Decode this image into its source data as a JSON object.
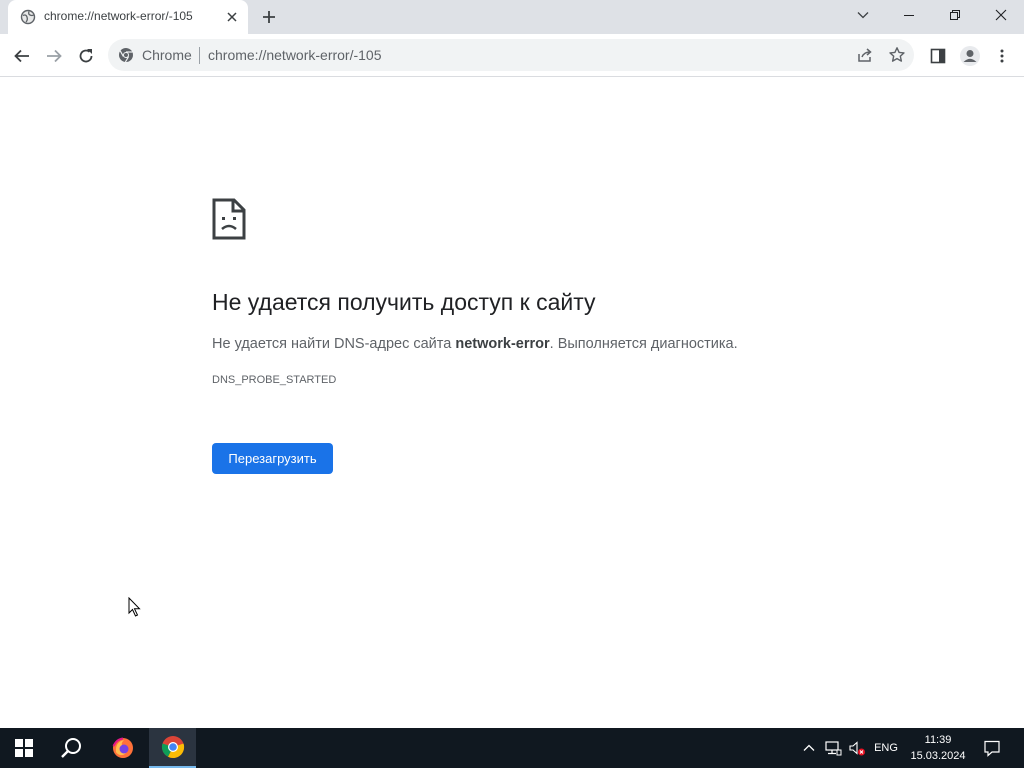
{
  "tab": {
    "title": "chrome://network-error/-105"
  },
  "omnibox": {
    "chip": "Chrome",
    "url": "chrome://network-error/-105"
  },
  "error": {
    "title": "Не удается получить доступ к сайту",
    "desc_prefix": "Не удается найти DNS-адрес сайта ",
    "desc_host": "network-error",
    "desc_suffix": ". Выполняется диагностика.",
    "code": "DNS_PROBE_STARTED",
    "reload_label": "Перезагрузить"
  },
  "taskbar": {
    "language": "ENG",
    "time": "11:39",
    "date": "15.03.2024"
  },
  "colors": {
    "accent": "#1a73e8",
    "taskbar": "#101820",
    "tabstrip": "#dee1e6"
  }
}
